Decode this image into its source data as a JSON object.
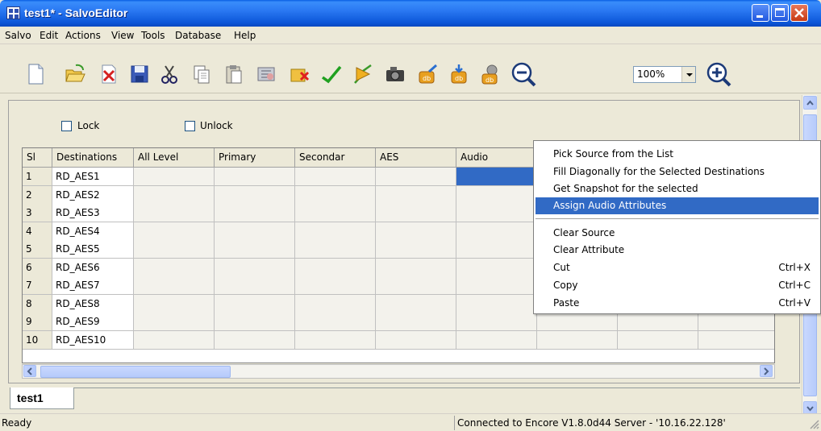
{
  "window": {
    "title": "test1* - SalvoEditor"
  },
  "menu": [
    "Salvo",
    "Edit",
    "Actions",
    "View",
    "Tools",
    "Database",
    "Help"
  ],
  "toolbar": {
    "icons": [
      "new-icon",
      "open-icon",
      "close-file-icon",
      "save-icon",
      "cut-icon",
      "copy-icon",
      "paste-icon",
      "fill-tool-icon",
      "clear-tool-icon",
      "check-icon",
      "take-icon",
      "snapshot-icon",
      "db-upload-icon",
      "db-download-icon",
      "db-settings-icon",
      "zoom-out-icon",
      "zoom-in-icon"
    ],
    "zoom_value": "100%"
  },
  "filters": {
    "lock_label": "Lock",
    "unlock_label": "Unlock"
  },
  "grid": {
    "columns": [
      "Sl",
      "Destinations",
      "All Level",
      "Primary",
      "Secondar",
      "AES",
      "Audio",
      "",
      "",
      ""
    ],
    "rows": [
      {
        "sl": "1",
        "dest": "RD_AES1"
      },
      {
        "sl": "2",
        "dest": "RD_AES2"
      },
      {
        "sl": "3",
        "dest": "RD_AES3"
      },
      {
        "sl": "4",
        "dest": "RD_AES4"
      },
      {
        "sl": "5",
        "dest": "RD_AES5"
      },
      {
        "sl": "6",
        "dest": "RD_AES6"
      },
      {
        "sl": "7",
        "dest": "RD_AES7"
      },
      {
        "sl": "8",
        "dest": "RD_AES8"
      },
      {
        "sl": "9",
        "dest": "RD_AES9"
      },
      {
        "sl": "10",
        "dest": "RD_AES10"
      }
    ]
  },
  "context_menu": {
    "items": [
      {
        "label": "Pick Source from the List",
        "shortcut": ""
      },
      {
        "label": "Fill Diagonally for the Selected Destinations",
        "shortcut": ""
      },
      {
        "label": "Get Snapshot for the selected",
        "shortcut": ""
      },
      {
        "label": "Assign Audio Attributes",
        "shortcut": ""
      },
      {
        "label": "Clear Source",
        "shortcut": ""
      },
      {
        "label": "Clear Attribute",
        "shortcut": ""
      },
      {
        "label": "Cut",
        "shortcut": "Ctrl+X"
      },
      {
        "label": "Copy",
        "shortcut": "Ctrl+C"
      },
      {
        "label": "Paste",
        "shortcut": "Ctrl+V"
      }
    ],
    "highlighted": "Assign Audio Attributes"
  },
  "tabs": [
    {
      "label": "test1"
    }
  ],
  "status": {
    "left": "Ready",
    "right": "Connected to Encore V1.8.0d44 Server - '10.16.22.128'"
  },
  "colors": {
    "title_blue": "#0c56d8",
    "selection_blue": "#316ac5",
    "face": "#ece9d8"
  }
}
